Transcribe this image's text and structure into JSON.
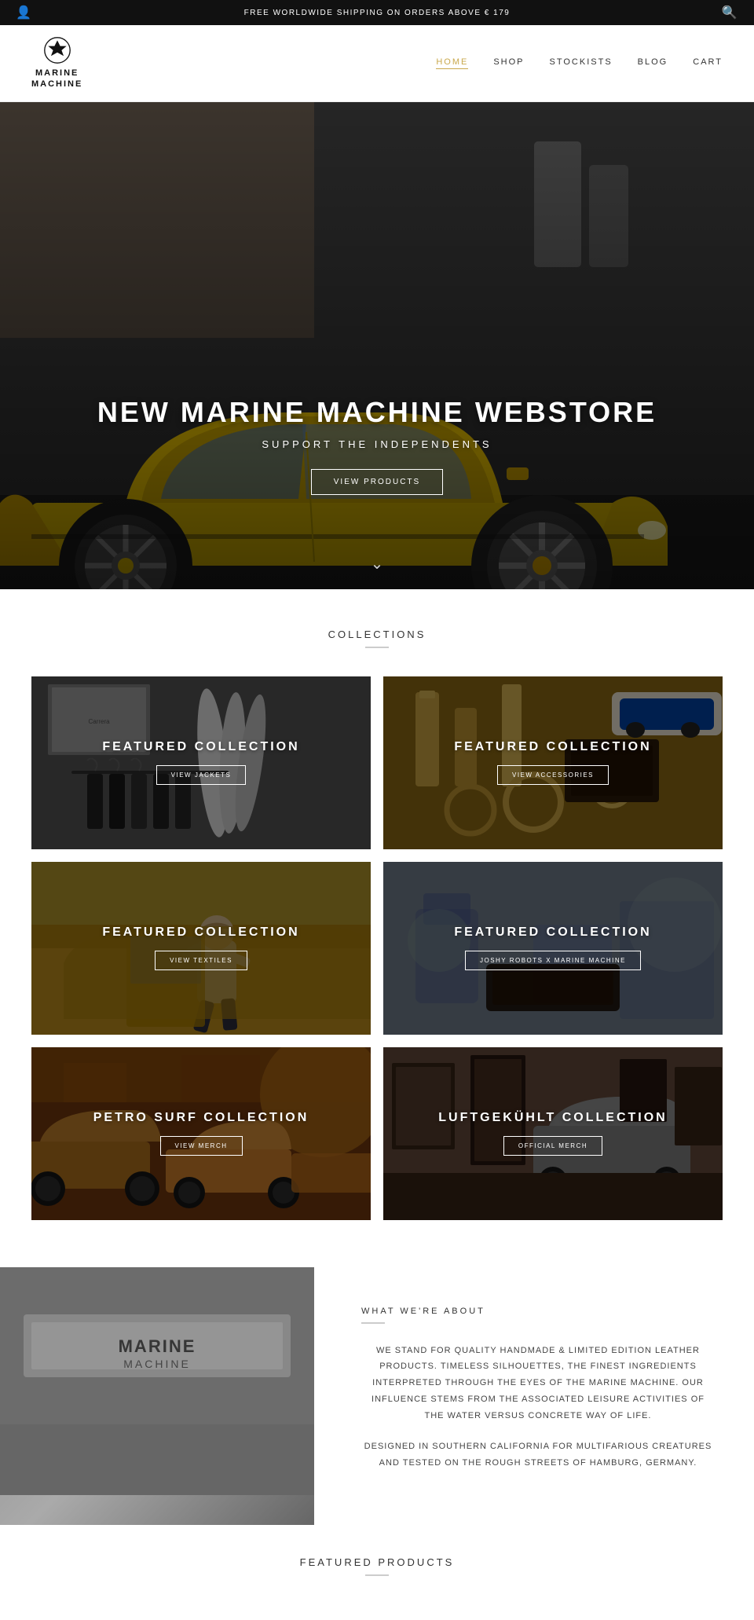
{
  "topbar": {
    "message": "FREE WORLDWIDE SHIPPING ON ORDERS ABOVE € 179",
    "userIcon": "👤",
    "searchIcon": "🔍"
  },
  "header": {
    "logoLine1": "MARINE",
    "logoLine2": "MACHINE",
    "nav": [
      {
        "label": "HOME",
        "active": true
      },
      {
        "label": "SHOP",
        "active": false
      },
      {
        "label": "STOCKISTS",
        "active": false
      },
      {
        "label": "BLOG",
        "active": false
      },
      {
        "label": "CART",
        "active": false
      }
    ]
  },
  "hero": {
    "title": "NEW MARINE MACHINE WEBSTORE",
    "subtitle": "SUPPORT THE INDEPENDENTS",
    "buttonLabel": "VIEW PRODUCTS"
  },
  "collections": {
    "sectionTitle": "COLLECTIONS",
    "items": [
      {
        "title": "FEATURED COLLECTION",
        "buttonLabel": "VIEW JACKETS",
        "cardClass": "card-jackets"
      },
      {
        "title": "FEATURED COLLECTION",
        "buttonLabel": "VIEW ACCESSORIES",
        "cardClass": "card-accessories"
      },
      {
        "title": "FEATURED COLLECTION",
        "buttonLabel": "VIEW TEXTILES",
        "cardClass": "card-textiles"
      },
      {
        "title": "FEATURED COLLECTION",
        "buttonLabel": "JOSHY ROBOTS X MARINE MACHINE",
        "cardClass": "card-joshy"
      },
      {
        "title": "PETRO SURF COLLECTION",
        "buttonLabel": "VIEW MERCH",
        "cardClass": "card-petro"
      },
      {
        "title": "LUFTGEKÜHLT COLLECTION",
        "buttonLabel": "OFFICIAL MERCH",
        "cardClass": "card-luftgekuhlt"
      }
    ]
  },
  "about": {
    "title": "WHAT WE'RE ABOUT",
    "paragraphs": [
      "WE STAND FOR QUALITY HANDMADE & LIMITED EDITION LEATHER PRODUCTS. TIMELESS SILHOUETTES, THE FINEST INGREDIENTS INTERPRETED THROUGH THE EYES OF THE MARINE MACHINE. OUR INFLUENCE STEMS FROM THE ASSOCIATED LEISURE ACTIVITIES OF THE WATER VERSUS CONCRETE WAY OF LIFE.",
      "DESIGNED IN SOUTHERN CALIFORNIA FOR MULTIFARIOUS CREATURES AND TESTED ON THE ROUGH STREETS OF HAMBURG, GERMANY."
    ]
  },
  "featuredProducts": {
    "sectionTitle": "FEATURED PRODUCTS"
  }
}
